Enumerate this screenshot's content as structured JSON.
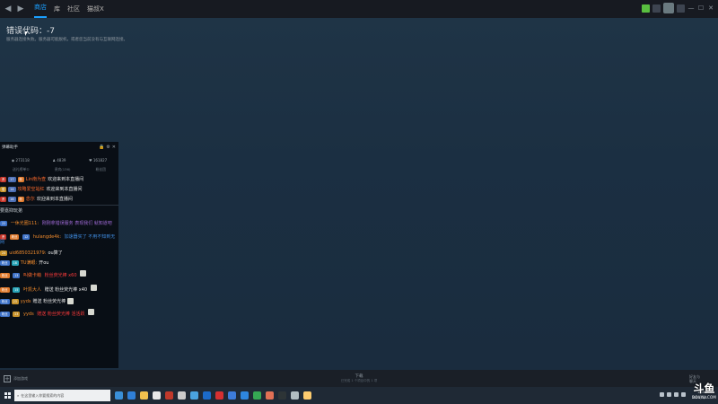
{
  "steam": {
    "menu": [
      {
        "label": "商店",
        "active": true
      },
      {
        "label": "库",
        "active": false
      },
      {
        "label": "社区",
        "active": false
      },
      {
        "label": "猫叔X",
        "active": false
      }
    ],
    "error_title": "错误代码：-7",
    "error_desc": "服务器连接失败。服务器可能脱机，或者您当前没有与互联网连接。",
    "add_game": "添加游戏",
    "download_title": "下载",
    "download_sub": "已完成 1 个项目中的 1 项",
    "friends": "好友与聊天"
  },
  "danmu": {
    "title": "弹幕助手",
    "stats": {
      "hot": "273118",
      "fans": "4839",
      "gifts": "161827"
    },
    "tabs": [
      "送礼榜单①",
      "贵宾(136)",
      "粉丝团"
    ],
    "welcome": [
      {
        "badge": "Lv",
        "level": "17",
        "user": "Lin南为查",
        "msg": "欢迎来到本直播间"
      },
      {
        "badge": "Lv",
        "level": "14",
        "user": "攻略爱空站红",
        "msg": "欢迎来到本直播间"
      },
      {
        "badge": "Lv",
        "level": "16",
        "user": "念尔",
        "msg": "欢迎来到本直播间"
      }
    ],
    "section": "要嘉抑玩弟",
    "messages": [
      {
        "level": "22",
        "user": "一休光圈111:",
        "msg": "刚刚拿错误服务 表现我们 就知道吧"
      },
      {
        "level": "12",
        "fan": "粉丝",
        "user": "hulangde4k:",
        "msg": "加速器买了 不用不知到无网"
      },
      {
        "level": "24",
        "user": "uid6850321979:",
        "msg": "ou算了"
      },
      {
        "level": "16",
        "fan": "粉丝",
        "user": "TU满眼:",
        "msg": "开ou"
      },
      {
        "level": "13",
        "fan": "粉丝",
        "user": "叫做卡萌",
        "msg": "粉丝荧光棒 x60"
      },
      {
        "level": "15",
        "fan": "粉丝",
        "user": "叶凯大人",
        "msg": "赠送 粉丝荧光棒 x40"
      },
      {
        "level": "23",
        "fan": "粉丝",
        "user": "yyds",
        "msg": "赠送 粉丝荧光棒"
      },
      {
        "level": "23",
        "fan": "粉丝",
        "user": "yyds",
        "msg": "赠送 粉丝荧光棒 活活跃"
      }
    ]
  },
  "taskbar": {
    "search_placeholder": "在这里输入你要搜索的内容",
    "time": "12:02",
    "date": "2021/1/1"
  },
  "watermark": {
    "logo": "斗鱼",
    "url": "DOUYU.COM"
  }
}
